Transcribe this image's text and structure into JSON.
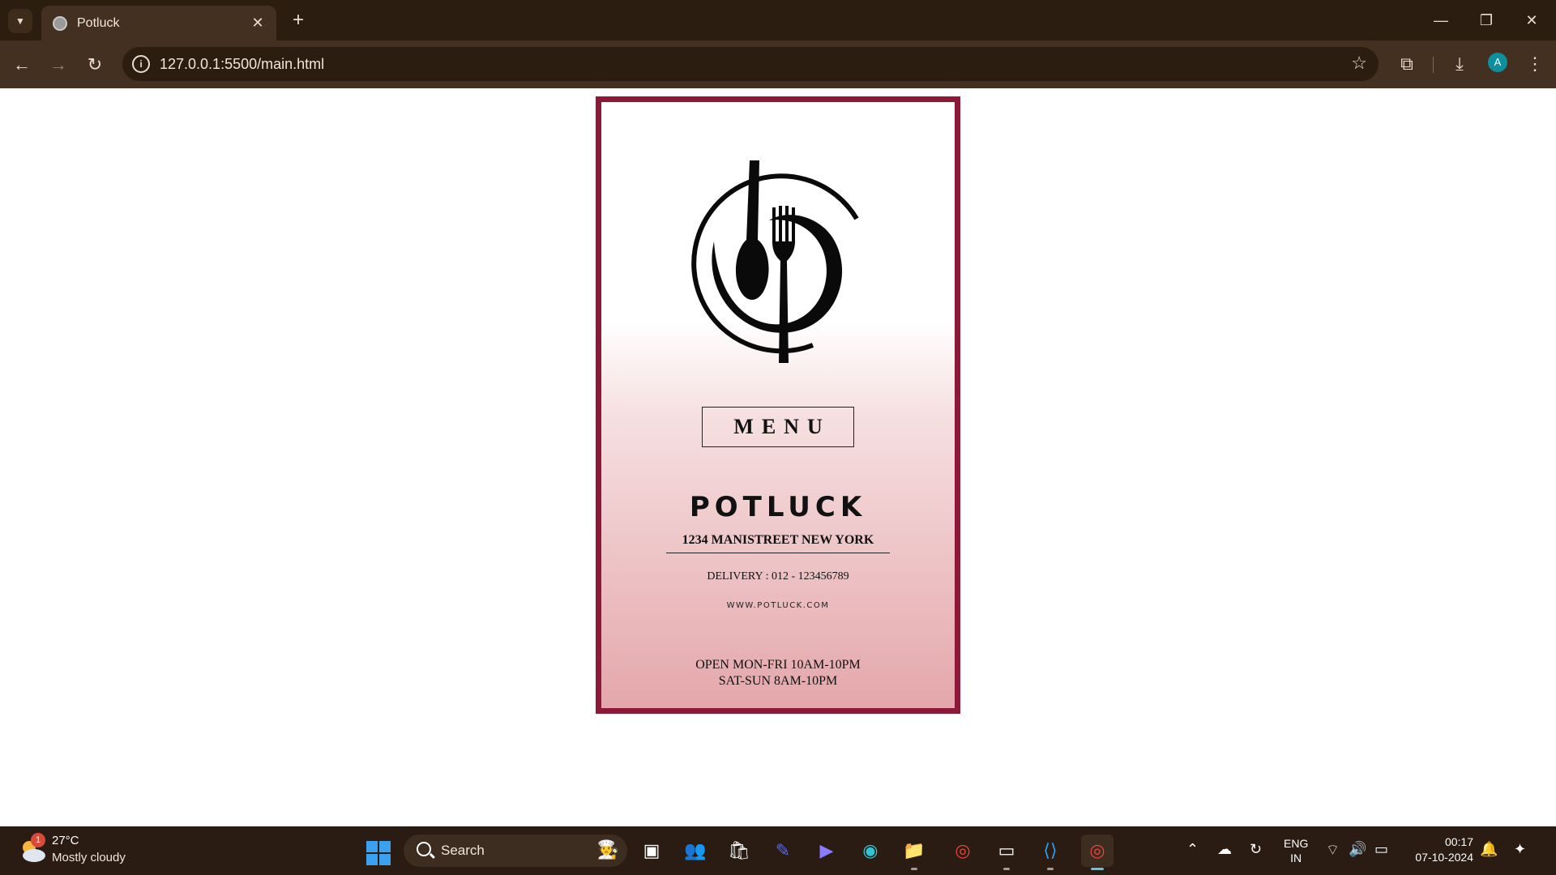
{
  "browser": {
    "tab_title": "Potluck",
    "url": "127.0.0.1:5500/main.html",
    "profile_initial": "A"
  },
  "menu": {
    "menu_label": "MENU",
    "brand": "POTLUCK",
    "address": "1234 MANISTREET NEW YORK",
    "delivery": "DELIVERY : 012 - 123456789",
    "website": "WWW.POTLUCK.COM",
    "hours_weekday": "OPEN MON-FRI 10AM-10PM",
    "hours_weekend": "SAT-SUN 8AM-10PM",
    "border_color": "#8e1838"
  },
  "taskbar": {
    "weather_badge": "1",
    "weather_temp": "27°C",
    "weather_desc": "Mostly cloudy",
    "search_label": "Search",
    "lang_top": "ENG",
    "lang_bottom": "IN",
    "time": "00:17",
    "date": "07-10-2024"
  }
}
